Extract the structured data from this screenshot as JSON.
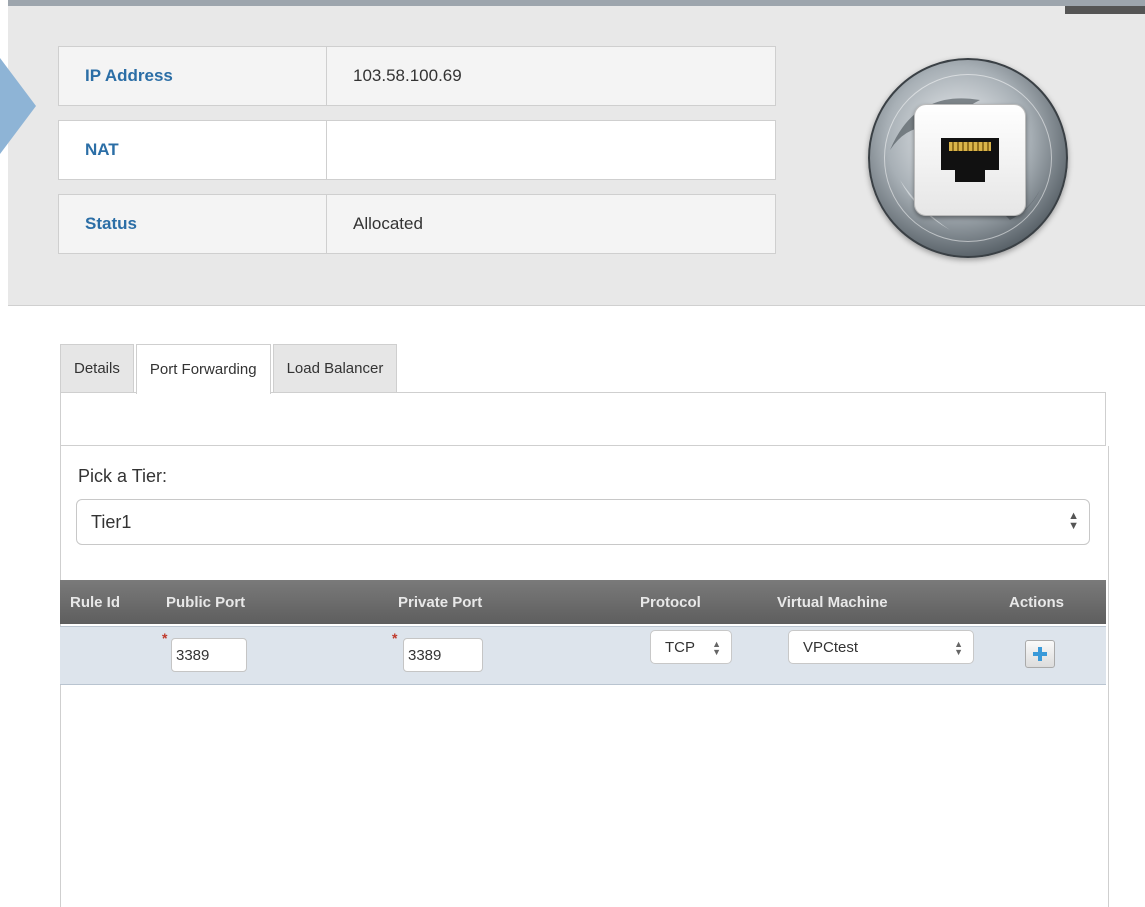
{
  "info": {
    "rows": [
      {
        "label": "IP Address",
        "value": "103.58.100.69"
      },
      {
        "label": "NAT",
        "value": ""
      },
      {
        "label": "Status",
        "value": "Allocated"
      }
    ]
  },
  "icon": {
    "name": "network-port-globe-icon",
    "accent": "#2b6ea6"
  },
  "tabs": [
    {
      "label": "Details",
      "active": false
    },
    {
      "label": "Port Forwarding",
      "active": true
    },
    {
      "label": "Load Balancer",
      "active": false
    }
  ],
  "tier": {
    "label": "Pick a Tier:",
    "selected": "Tier1"
  },
  "table": {
    "columns": [
      "Rule Id",
      "Public Port",
      "Private Port",
      "Protocol",
      "Virtual Machine",
      "Actions"
    ],
    "new_rule": {
      "rule_id": "",
      "public_port": "3389",
      "private_port": "3389",
      "protocol": "TCP",
      "virtual_machine": "VPCtest",
      "required_marker": "*"
    }
  }
}
